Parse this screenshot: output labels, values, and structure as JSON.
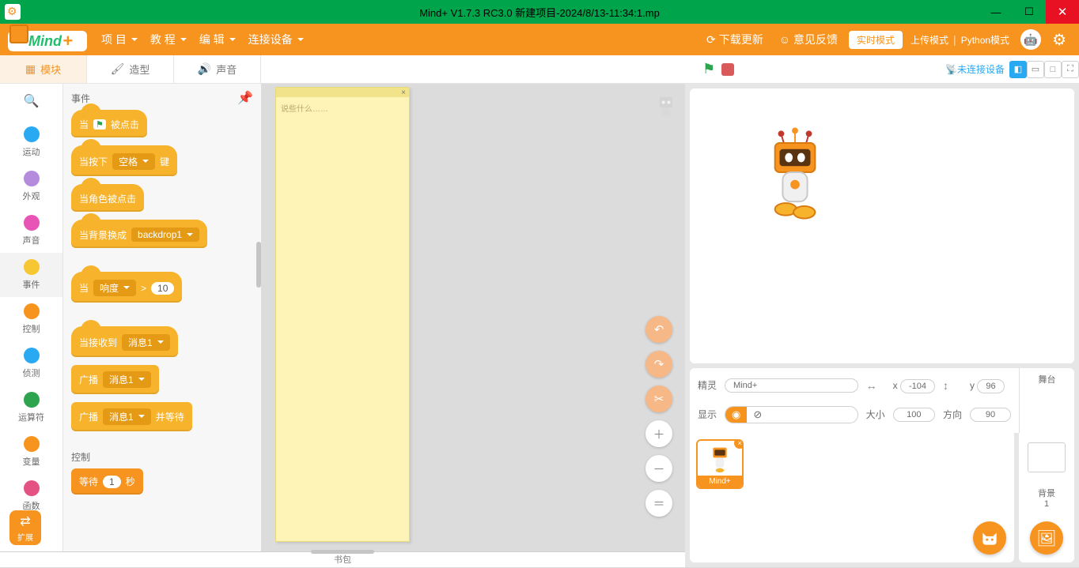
{
  "titlebar": {
    "title": "Mind+ V1.7.3 RC3.0   新建项目-2024/8/13-11:34:1.mp"
  },
  "menubar": {
    "logo_text": "Mind",
    "logo_plus": "+",
    "items": [
      "项 目",
      "教 程",
      "编 辑",
      "连接设备"
    ],
    "download": "下载更新",
    "feedback": "意见反馈",
    "mode_realtime": "实时模式",
    "mode_upload": "上传模式",
    "mode_python": "Python模式"
  },
  "tabs": {
    "code": "模块",
    "costumes": "造型",
    "sounds": "声音"
  },
  "stage_ctrl": {
    "conn": "未连接设备"
  },
  "categories": [
    {
      "label": "运动",
      "color": "#2aa9f3"
    },
    {
      "label": "外观",
      "color": "#b58bde"
    },
    {
      "label": "声音",
      "color": "#e754b6"
    },
    {
      "label": "事件",
      "color": "#f7c733"
    },
    {
      "label": "控制",
      "color": "#f7941f"
    },
    {
      "label": "侦测",
      "color": "#2aa9f3"
    },
    {
      "label": "运算符",
      "color": "#2ea44f"
    },
    {
      "label": "变量",
      "color": "#f7941f"
    },
    {
      "label": "函数",
      "color": "#e45283"
    }
  ],
  "palette": {
    "hdr_events": "事件",
    "hdr_control": "控制",
    "b_flag_pre": "当",
    "b_flag_post": "被点击",
    "b_key_pre": "当按下",
    "b_key_drop": "空格",
    "b_key_post": "键",
    "b_sprite": "当角色被点击",
    "b_backdrop_pre": "当背景换成",
    "b_backdrop_drop": "backdrop1",
    "b_loud_pre": "当",
    "b_loud_drop": "响度",
    "b_loud_gt": ">",
    "b_loud_val": "10",
    "b_recv_pre": "当接收到",
    "b_recv_drop": "消息1",
    "b_broadcast_pre": "广播",
    "b_broadcast_drop": "消息1",
    "b_bwait_pre": "广播",
    "b_bwait_drop": "消息1",
    "b_bwait_post": "并等待",
    "b_wait_pre": "等待",
    "b_wait_val": "1",
    "b_wait_post": "秒"
  },
  "note": {
    "placeholder": "说些什么……"
  },
  "backpack": "书包",
  "ext": "扩展",
  "sprite_info": {
    "sprite_lbl": "精灵",
    "sprite_name": "Mind+",
    "x_lbl": "x",
    "x": "-104",
    "y_lbl": "y",
    "y": "96",
    "show_lbl": "显示",
    "size_lbl": "大小",
    "size": "100",
    "dir_lbl": "方向",
    "dir": "90"
  },
  "stage_col": {
    "stage": "舞台",
    "backdrop": "背景",
    "count": "1"
  },
  "sprite_card": {
    "name": "Mind+"
  }
}
